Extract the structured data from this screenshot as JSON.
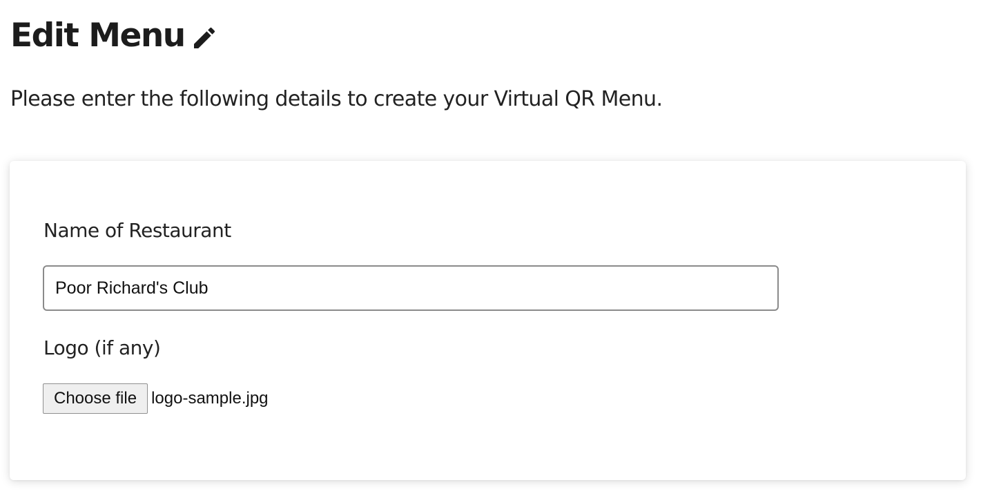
{
  "header": {
    "title": "Edit Menu",
    "title_icon": "pencil-icon",
    "subtitle": "Please enter the following details to create your Virtual QR Menu."
  },
  "form": {
    "restaurant_name": {
      "label": "Name of Restaurant",
      "value": "Poor Richard's Club"
    },
    "logo": {
      "label": "Logo (if any)",
      "button_label": "Choose file",
      "file_name": "logo-sample.jpg"
    }
  },
  "colors": {
    "text": "#1c1c1c",
    "input_border": "#8a8a8a",
    "file_button_bg": "#efefef"
  }
}
